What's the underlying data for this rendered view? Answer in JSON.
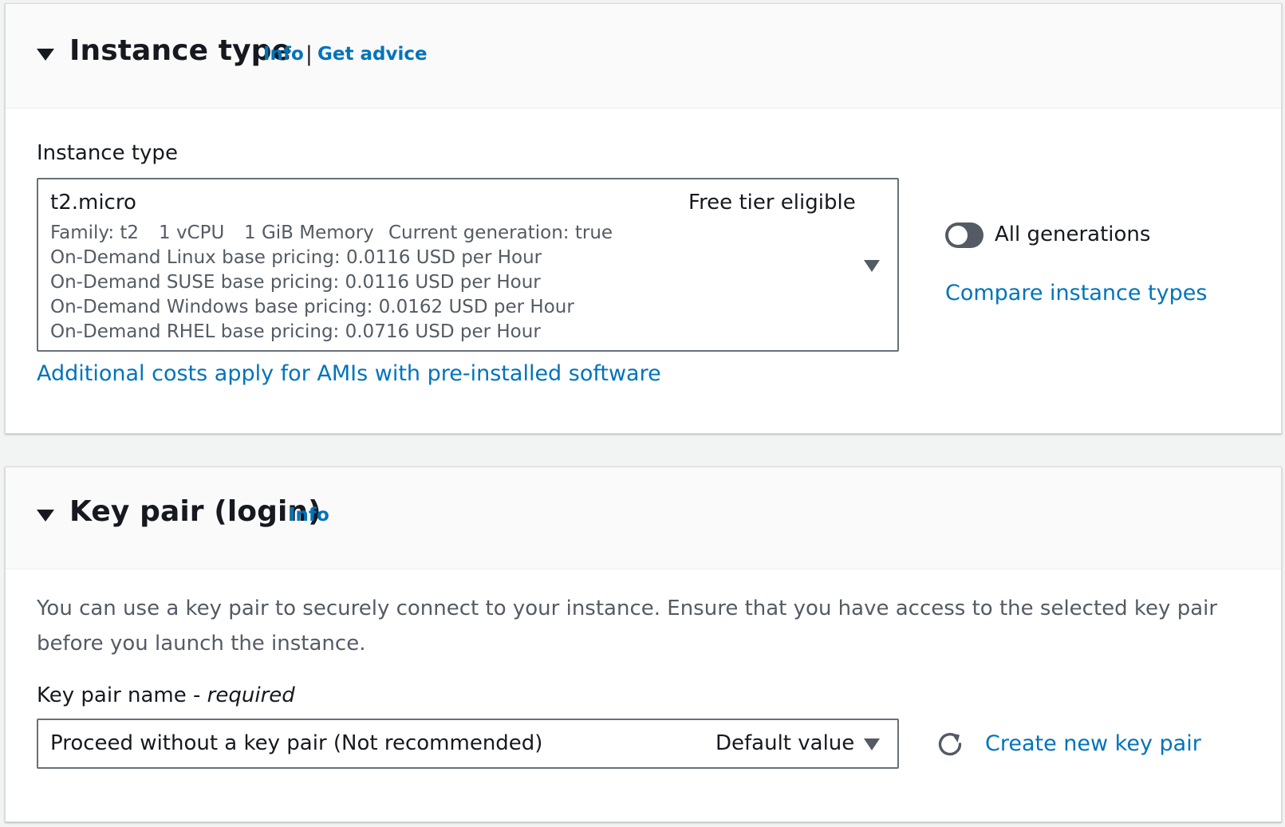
{
  "instance_section": {
    "title": "Instance type",
    "info_link": "Info",
    "separator": "|",
    "advice_link": "Get advice",
    "field_label": "Instance type",
    "selected": {
      "name": "t2.micro",
      "badge": "Free tier eligible",
      "family": "Family: t2",
      "vcpu": "1 vCPU",
      "memory": "1 GiB Memory",
      "generation": "Current generation: true",
      "pricing": [
        "On-Demand Linux base pricing: 0.0116 USD per Hour",
        "On-Demand SUSE base pricing: 0.0116 USD per Hour",
        "On-Demand Windows base pricing: 0.0162 USD per Hour",
        "On-Demand RHEL base pricing: 0.0716 USD per Hour"
      ]
    },
    "toggle_label": "All generations",
    "compare_link": "Compare instance types",
    "costs_link": "Additional costs apply for AMIs with pre-installed software"
  },
  "keypair_section": {
    "title": "Key pair (login)",
    "info_link": "Info",
    "description": "You can use a key pair to securely connect to your instance. Ensure that you have access to the selected key pair before you launch the instance.",
    "field_label": "Key pair name - ",
    "field_label_required": "required",
    "selected_value": "Proceed without a key pair (Not recommended)",
    "selected_badge": "Default value",
    "create_link": "Create new key pair"
  },
  "colors": {
    "link": "#0073bb",
    "text": "#16191f",
    "secondary_text": "#545b64",
    "border": "#687078",
    "header_bg": "#fafafa",
    "page_bg": "#f2f3f3"
  }
}
